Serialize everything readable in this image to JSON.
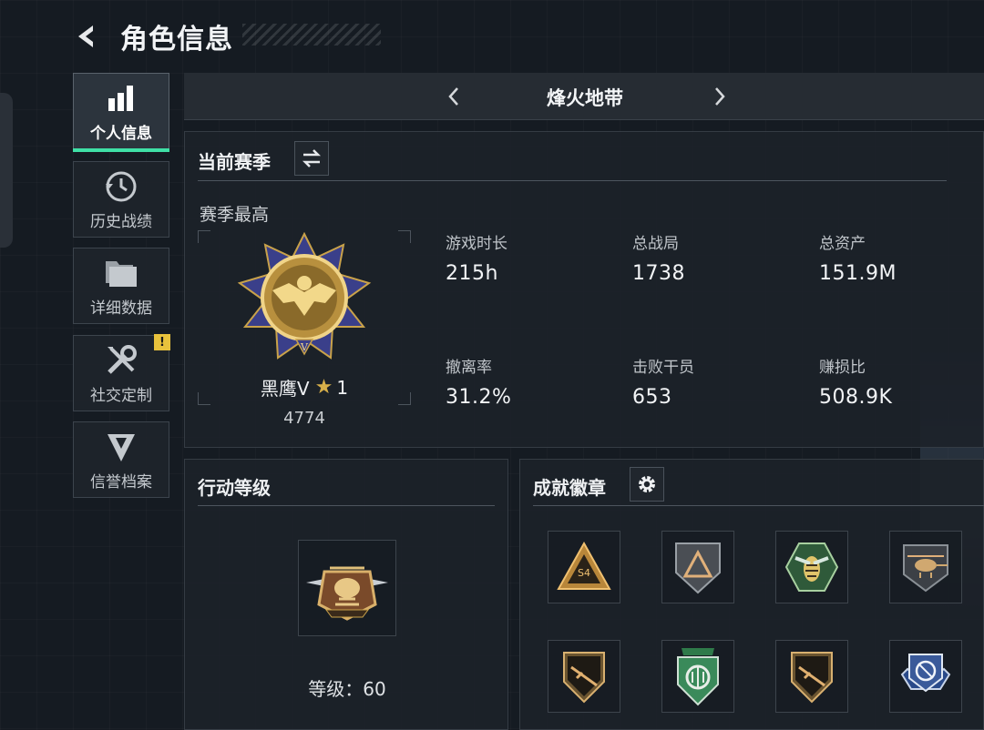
{
  "header": {
    "title": "角色信息",
    "back_icon": "back-arrow-icon"
  },
  "sidebar": {
    "items": [
      {
        "label": "个人信息",
        "icon": "bar-chart-icon",
        "active": true
      },
      {
        "label": "历史战绩",
        "icon": "history-clock-icon",
        "active": false
      },
      {
        "label": "详细数据",
        "icon": "folder-icon",
        "active": false
      },
      {
        "label": "社交定制",
        "icon": "wrench-screwdriver-icon",
        "active": false,
        "badge": "!"
      },
      {
        "label": "信誉档案",
        "icon": "shield-chevron-icon",
        "active": false
      }
    ]
  },
  "mode_selector": {
    "title": "烽火地带",
    "prev_icon": "chevron-left-icon",
    "next_icon": "chevron-right-icon"
  },
  "season": {
    "heading": "当前赛季",
    "switch_icon": "swap-arrows-icon",
    "best_label": "赛季最高",
    "rank": {
      "name": "黑鹰V",
      "star_icon": "star-icon",
      "stars": "1",
      "score": "4774"
    },
    "stats": [
      {
        "label": "游戏时长",
        "value": "215h"
      },
      {
        "label": "总战局",
        "value": "1738"
      },
      {
        "label": "总资产",
        "value": "151.9M"
      },
      {
        "label": "撤离率",
        "value": "31.2%"
      },
      {
        "label": "击败干员",
        "value": "653"
      },
      {
        "label": "赚损比",
        "value": "508.9K"
      }
    ]
  },
  "action_level": {
    "heading": "行动等级",
    "level_text": "等级：60",
    "emblem_icon": "helicopter-emblem-icon"
  },
  "achievements": {
    "heading": "成就徽章",
    "settings_icon": "gear-icon",
    "badges": [
      "s4-warning-badge-icon",
      "triangle-shield-badge-icon",
      "hornet-badge-icon",
      "helicopter-badge-icon",
      "rifle-shield-badge-icon",
      "green-shield-badge-icon",
      "rifle-shield-badge-icon",
      "target-crest-badge-icon"
    ]
  },
  "colors": {
    "accent": "#3fe0a6",
    "gold": "#d8b04a",
    "alert": "#e8c23c",
    "panel": "#1c2229"
  }
}
